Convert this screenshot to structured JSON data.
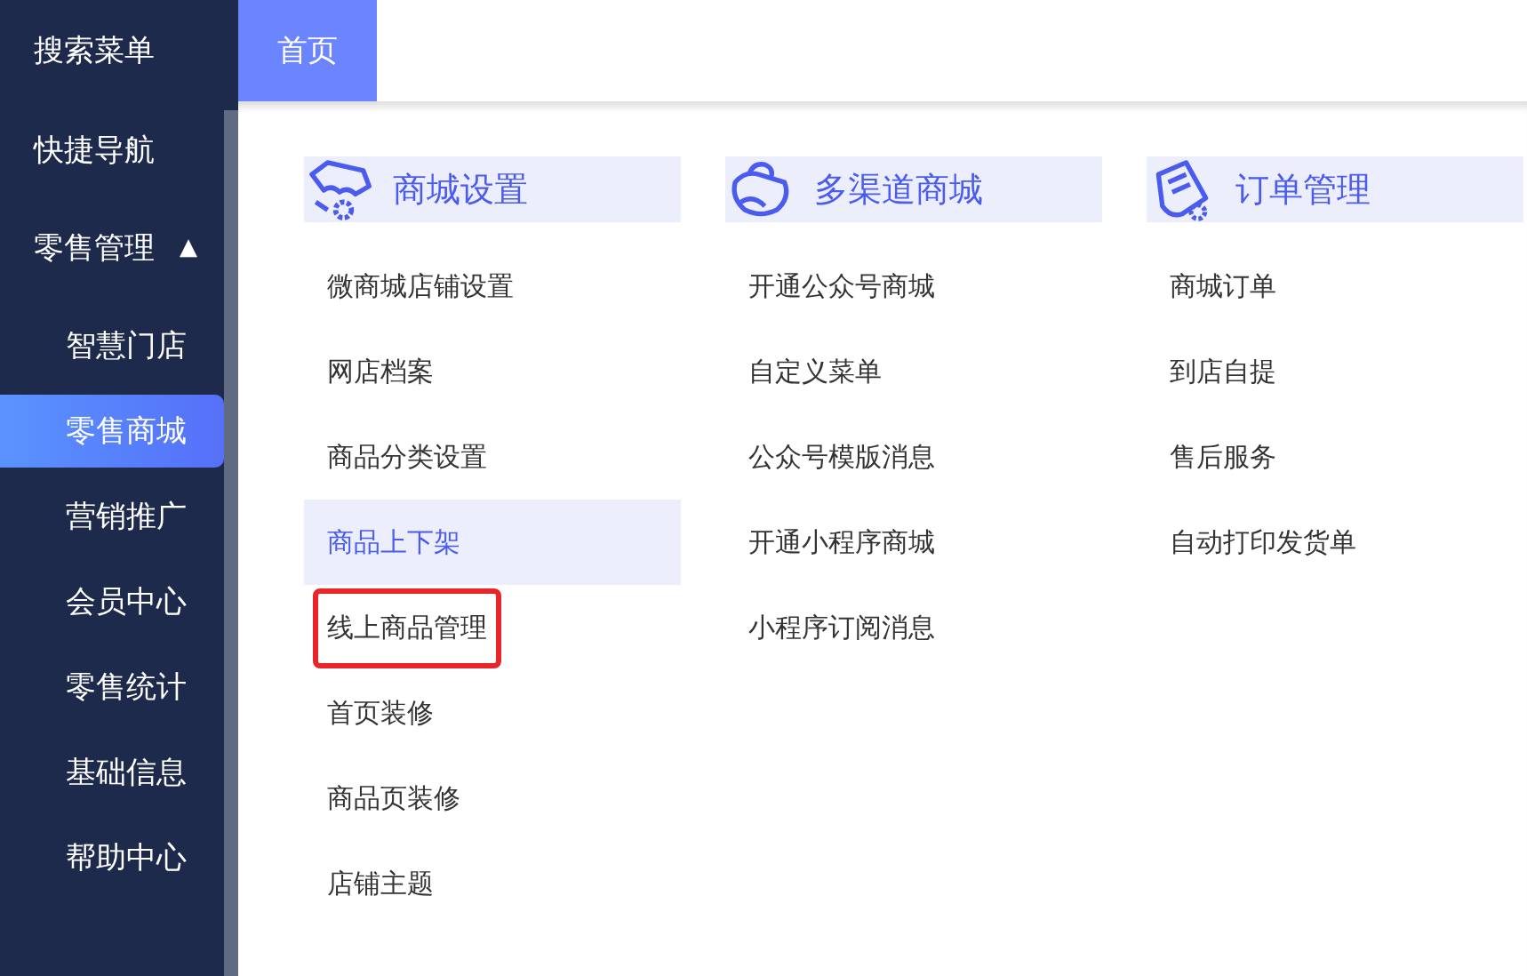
{
  "sidebar": {
    "items": [
      {
        "label": "搜索菜单",
        "kind": "top"
      },
      {
        "label": "快捷导航",
        "kind": "top"
      },
      {
        "label": "零售管理",
        "kind": "group",
        "expanded": true,
        "toggle": "▲",
        "children": [
          {
            "label": "智慧门店",
            "selected": false
          },
          {
            "label": "零售商城",
            "selected": true
          },
          {
            "label": "营销推广",
            "selected": false
          },
          {
            "label": "会员中心",
            "selected": false
          },
          {
            "label": "零售统计",
            "selected": false
          },
          {
            "label": "基础信息",
            "selected": false
          },
          {
            "label": "帮助中心",
            "selected": false
          }
        ]
      }
    ]
  },
  "tabs": [
    {
      "label": "首页",
      "selected": true
    }
  ],
  "menu_columns": [
    {
      "title": "商城设置",
      "kind": "shop",
      "items": [
        {
          "label": "微商城店铺设置",
          "selected": false,
          "outlined": false
        },
        {
          "label": "网店档案",
          "selected": false,
          "outlined": false
        },
        {
          "label": "商品分类设置",
          "selected": false,
          "outlined": false
        },
        {
          "label": "商品上下架",
          "selected": true,
          "outlined": false
        },
        {
          "label": "线上商品管理",
          "selected": false,
          "outlined": true
        },
        {
          "label": "首页装修",
          "selected": false,
          "outlined": false
        },
        {
          "label": "商品页装修",
          "selected": false,
          "outlined": false
        },
        {
          "label": "店铺主题",
          "selected": false,
          "outlined": false
        }
      ]
    },
    {
      "title": "多渠道商城",
      "kind": "bag",
      "items": [
        {
          "label": "开通公众号商城",
          "selected": false,
          "outlined": false
        },
        {
          "label": "自定义菜单",
          "selected": false,
          "outlined": false
        },
        {
          "label": "公众号模版消息",
          "selected": false,
          "outlined": false
        },
        {
          "label": "开通小程序商城",
          "selected": false,
          "outlined": false
        },
        {
          "label": "小程序订阅消息",
          "selected": false,
          "outlined": false
        }
      ]
    },
    {
      "title": "订单管理",
      "kind": "order",
      "items": [
        {
          "label": "商城订单",
          "selected": false,
          "outlined": false
        },
        {
          "label": "到店自提",
          "selected": false,
          "outlined": false
        },
        {
          "label": "售后服务",
          "selected": false,
          "outlined": false
        },
        {
          "label": "自动打印发货单",
          "selected": false,
          "outlined": false
        }
      ]
    }
  ]
}
